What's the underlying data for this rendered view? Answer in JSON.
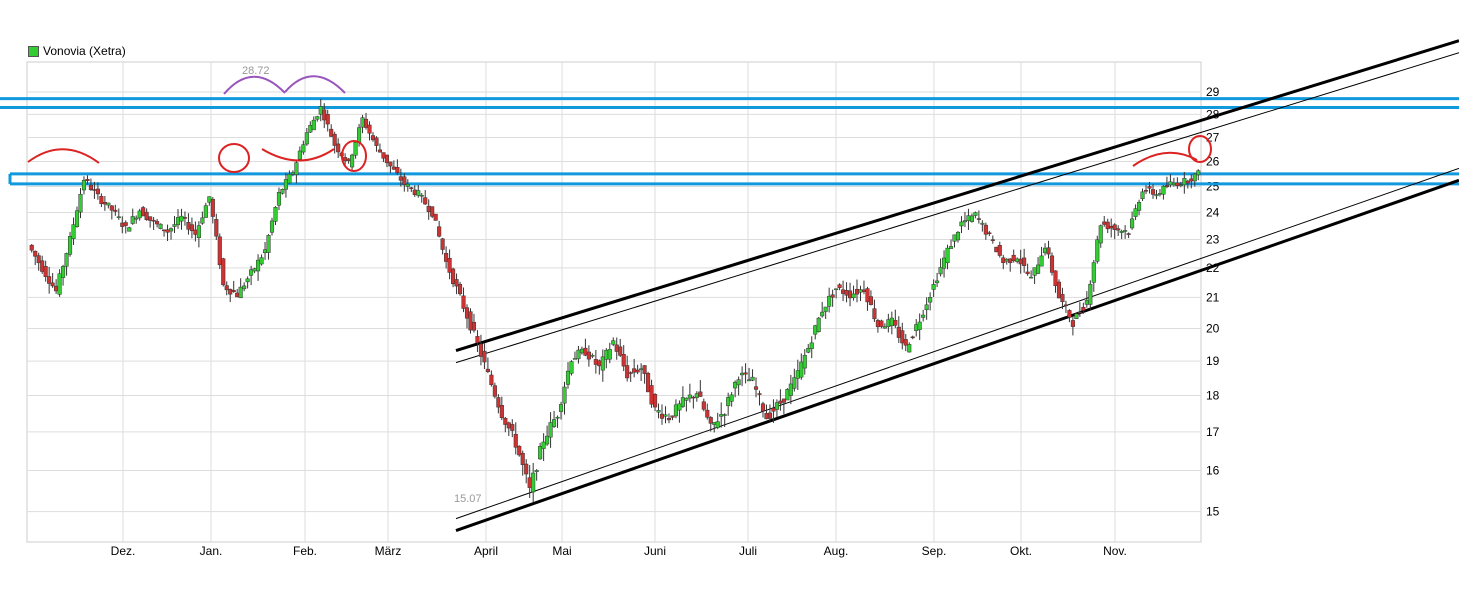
{
  "legend": {
    "label": "Vonovia (Xetra)",
    "color": "#33cc33"
  },
  "annotations": {
    "high_label": "28.72",
    "low_label": "15.07"
  },
  "colors": {
    "up": "#33cc33",
    "down": "#cc3333",
    "support": "#1199dd",
    "marker": "#dd2222",
    "marker_alt": "#9955bb",
    "grid": "#dddddd"
  },
  "chart_data": {
    "type": "candlestick",
    "series_name": "Vonovia (Xetra)",
    "x_labels": [
      "Dez.",
      "Jan.",
      "Feb.",
      "März",
      "April",
      "Mai",
      "Juni",
      "Juli",
      "Aug.",
      "Sep.",
      "Okt.",
      "Nov."
    ],
    "y_ticks": [
      15,
      16,
      17,
      18,
      19,
      20,
      21,
      22,
      23,
      24,
      25,
      26,
      27,
      28,
      29
    ],
    "y_scale": "log",
    "ylim": [
      14.3,
      30.4
    ],
    "grid": true,
    "legend_position": "top-left",
    "high": 28.72,
    "low": 15.07,
    "horizontal_levels": [
      28.3,
      28.7,
      25.1,
      25.5
    ],
    "trend_channel": {
      "upper": [
        [
          "April",
          19.6
        ],
        [
          "Nov.",
          26.6
        ]
      ],
      "lower": [
        [
          "April",
          14.8
        ],
        [
          "Nov.",
          20.9
        ]
      ]
    },
    "close_path": [
      [
        "Nov. (prev)",
        22.8
      ],
      [
        "",
        22.0
      ],
      [
        "",
        21.2
      ],
      [
        "",
        23.0
      ],
      [
        "",
        25.3
      ],
      [
        "",
        24.6
      ],
      [
        "",
        24.1
      ],
      [
        "",
        23.4
      ],
      [
        "Dez.",
        24.1
      ],
      [
        "",
        23.6
      ],
      [
        "",
        23.3
      ],
      [
        "",
        23.8
      ],
      [
        "",
        23.2
      ],
      [
        "",
        24.6
      ],
      [
        "",
        21.4
      ],
      [
        "",
        21.1
      ],
      [
        "Jan.",
        21.8
      ],
      [
        "",
        22.6
      ],
      [
        "",
        24.7
      ],
      [
        "",
        25.6
      ],
      [
        "",
        27.2
      ],
      [
        "",
        28.3
      ],
      [
        "",
        26.7
      ],
      [
        "",
        25.9
      ],
      [
        "Feb.",
        27.8
      ],
      [
        "",
        26.6
      ],
      [
        "",
        25.8
      ],
      [
        "",
        25.1
      ],
      [
        "",
        24.7
      ],
      [
        "",
        24.0
      ],
      [
        "",
        22.2
      ],
      [
        "",
        21.0
      ],
      [
        "März",
        19.8
      ],
      [
        "",
        18.6
      ],
      [
        "",
        17.5
      ],
      [
        "",
        16.7
      ],
      [
        "",
        15.5
      ],
      [
        "",
        16.8
      ],
      [
        "",
        17.5
      ],
      [
        "",
        19.1
      ],
      [
        "April",
        19.3
      ],
      [
        "",
        18.8
      ],
      [
        "",
        19.6
      ],
      [
        "",
        18.6
      ],
      [
        "",
        18.8
      ],
      [
        "",
        17.6
      ],
      [
        "",
        17.4
      ],
      [
        "",
        17.8
      ],
      [
        "Mai",
        18.1
      ],
      [
        "",
        17.1
      ],
      [
        "",
        17.6
      ],
      [
        "",
        18.6
      ],
      [
        "",
        18.4
      ],
      [
        "",
        17.4
      ],
      [
        "",
        17.8
      ],
      [
        "",
        18.4
      ],
      [
        "Juni",
        19.4
      ],
      [
        "",
        20.6
      ],
      [
        "",
        21.3
      ],
      [
        "",
        21.1
      ],
      [
        "",
        21.3
      ],
      [
        "",
        20.1
      ],
      [
        "",
        20.2
      ],
      [
        "",
        19.4
      ],
      [
        "Juli",
        20.3
      ],
      [
        "",
        21.4
      ],
      [
        "",
        22.6
      ],
      [
        "",
        23.6
      ],
      [
        "",
        23.9
      ],
      [
        "",
        23.1
      ],
      [
        "",
        22.2
      ],
      [
        "",
        22.4
      ],
      [
        "Aug.",
        21.6
      ],
      [
        "",
        22.8
      ],
      [
        "",
        21.0
      ],
      [
        "",
        20.2
      ],
      [
        "",
        20.9
      ],
      [
        "",
        23.6
      ],
      [
        "",
        23.4
      ],
      [
        "",
        23.3
      ],
      [
        "Sep.",
        24.9
      ],
      [
        "",
        24.7
      ],
      [
        "",
        25.1
      ],
      [
        "",
        25.2
      ],
      [
        "",
        25.5
      ]
    ]
  }
}
